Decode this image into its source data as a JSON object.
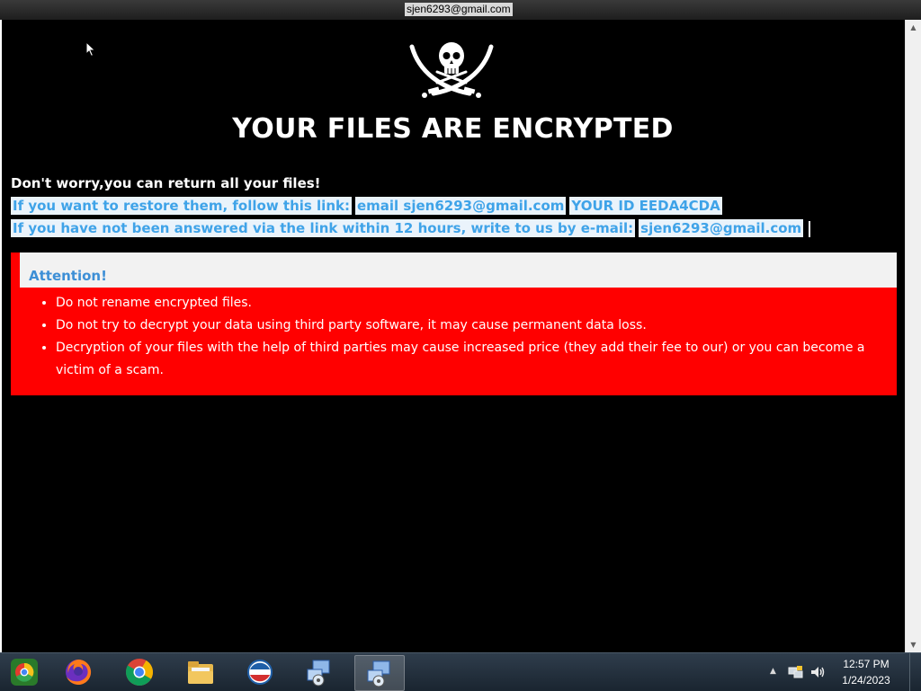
{
  "window": {
    "title": "sjen6293@gmail.com"
  },
  "note": {
    "headline": "YOUR FILES ARE ENCRYPTED",
    "reassurance": "Don't worry,you can return all your files!",
    "restore_line": {
      "prefix": "If you want to restore them, follow this link:",
      "link": "email sjen6293@gmail.com",
      "id_text": "YOUR ID EEDA4CDA"
    },
    "fallback_line": {
      "prefix": "If you have not been answered via the link within 12 hours, write to us by e-mail:",
      "email": "sjen6293@gmail.com"
    },
    "attention": {
      "title": "Attention!",
      "items": [
        "Do not rename encrypted files.",
        "Do not try to decrypt your data using third party software, it may cause permanent data loss.",
        "Decryption of your files with the help of third parties may cause increased price (they add their fee to our) or you can become a victim of a scam."
      ]
    }
  },
  "taskbar": {
    "icons": [
      "start-orb-icon",
      "firefox-icon",
      "chrome-icon",
      "file-explorer-icon",
      "ie-icon",
      "network-setup-icon",
      "network-setup-icon-active"
    ],
    "clock": {
      "time": "12:57 PM",
      "date": "1/24/2023"
    }
  },
  "colors": {
    "background": "#000000",
    "highlight_text": "#3fa3e8",
    "alert_red": "#ff0000"
  }
}
